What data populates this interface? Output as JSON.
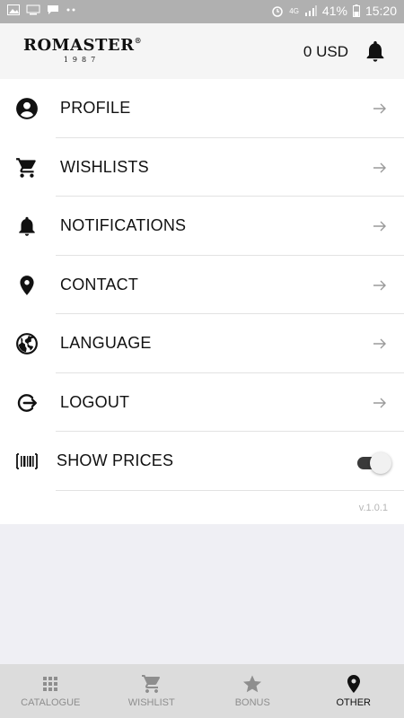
{
  "status_bar": {
    "network": "4G",
    "battery": "41%",
    "time": "15:20"
  },
  "header": {
    "logo_name": "ROMASTER",
    "logo_reg": "®",
    "logo_year": "1987",
    "balance": "0 USD"
  },
  "menu": {
    "items": [
      {
        "label": "PROFILE",
        "icon": "profile-icon"
      },
      {
        "label": "WISHLISTS",
        "icon": "cart-icon"
      },
      {
        "label": "NOTIFICATIONS",
        "icon": "bell-icon"
      },
      {
        "label": "CONTACT",
        "icon": "location-pin-icon"
      },
      {
        "label": "LANGUAGE",
        "icon": "globe-icon"
      },
      {
        "label": "LOGOUT",
        "icon": "logout-icon"
      }
    ],
    "show_prices": {
      "label": "SHOW PRICES",
      "icon": "barcode-icon",
      "enabled": true
    },
    "version": "v.1.0.1"
  },
  "tabbar": {
    "tabs": [
      {
        "label": "CATALOGUE",
        "icon": "grid-icon",
        "active": false
      },
      {
        "label": "WISHLIST",
        "icon": "cart-icon",
        "active": false
      },
      {
        "label": "BONUS",
        "icon": "star-icon",
        "active": false
      },
      {
        "label": "OTHER",
        "icon": "location-pin-icon",
        "active": true
      }
    ]
  },
  "colors": {
    "status_bar": "#b0b0b0",
    "header_bg": "#f5f5f5",
    "page_bg": "#efeff4",
    "tabbar_bg": "#dcdcdc",
    "active": "#111111",
    "inactive": "#8e8e8e"
  }
}
